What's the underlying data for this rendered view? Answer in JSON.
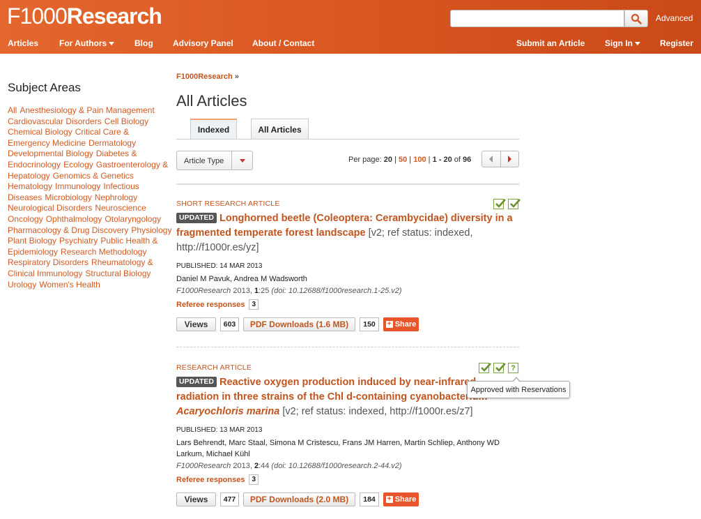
{
  "header": {
    "logo_light": "F1000",
    "logo_bold": "Research",
    "search": {
      "value": "",
      "placeholder": ""
    },
    "advanced": "Advanced",
    "nav_left": [
      "Articles",
      "For Authors",
      "Blog",
      "Advisory Panel",
      "About / Contact"
    ],
    "nav_right": [
      "Submit an Article",
      "Sign In",
      "Register"
    ]
  },
  "sidebar": {
    "title": "Subject Areas",
    "subjects": [
      "All",
      "Anesthesiology & Pain Management",
      "Cardiovascular Disorders",
      "Cell Biology",
      "Chemical Biology",
      "Critical Care &",
      "Emergency Medicine",
      "Dermatology",
      "Developmental Biology",
      "Diabetes &",
      "Endocrinology",
      "Ecology",
      "Gastroenterology &",
      "Hepatology",
      "Genomics & Genetics",
      "Hematology",
      "Immunology",
      "Infectious",
      "Diseases",
      "Microbiology",
      "Nephrology",
      "Neurological Disorders",
      "Neuroscience",
      "Oncology",
      "Ophthalmology",
      "Otolaryngology",
      "Pharmacology & Drug Discovery",
      "Physiology",
      "Plant Biology",
      "Psychiatry",
      "Public Health &",
      "Epidemiology",
      "Research Methodology",
      "Respiratory Disorders",
      "Rheumatology &",
      "Clinical Immunology",
      "Structural Biology",
      "Urology",
      "Women's Health"
    ]
  },
  "breadcrumb": {
    "home": "F1000Research",
    "sep": "»"
  },
  "page_title": "All Articles",
  "tabs": [
    "Indexed",
    "All Articles"
  ],
  "filter": {
    "article_type": "Article Type"
  },
  "pagination": {
    "per_page_label": "Per page:",
    "current": "20",
    "options": [
      "50",
      "100"
    ],
    "range": "1 - 20",
    "of": "of",
    "total": "96"
  },
  "articles": [
    {
      "type": "SHORT RESEARCH ARTICLE",
      "badge": "UPDATED",
      "title": "Longhorned beetle (Coleoptera: Cerambycidae) diversity in a fragmented temperate forest landscape",
      "meta": "[v2; ref status: indexed, http://f1000r.es/yz]",
      "published": "PUBLISHED: 14 MAR 2013",
      "authors": "Daniel M Pavuk, Andrea M Wadsworth",
      "journal": "F1000Research",
      "year_vol": "2013,",
      "volume": "1",
      "page": ":25",
      "doi": "(doi: 10.12688/f1000research.1-25.v2)",
      "referee_label": "Referee responses",
      "referee_count": "3",
      "views_label": "Views",
      "views": "603",
      "pdf_label": "PDF Downloads (1.6 MB)",
      "downloads": "150",
      "share_label": "Share",
      "statuses": [
        "approved",
        "approved"
      ]
    },
    {
      "type": "RESEARCH ARTICLE",
      "badge": "UPDATED",
      "title": "Reactive oxygen production induced by near-infrared radiation in three strains of the Chl d-containing cyanobacterium",
      "title_italic": "Acaryochloris marina",
      "meta": "[v2; ref status: indexed, http://f1000r.es/z7]",
      "published": "PUBLISHED: 13 MAR 2013",
      "authors": "Lars Behrendt, Marc Staal, Simona M Cristescu, Frans JM Harren, Martin Schliep, Anthony WD Larkum, Michael Kühl",
      "journal": "F1000Research",
      "year_vol": "2013,",
      "volume": "2",
      "page": ":44",
      "doi": "(doi: 10.12688/f1000research.2-44.v2)",
      "referee_label": "Referee responses",
      "referee_count": "3",
      "views_label": "Views",
      "views": "477",
      "pdf_label": "PDF Downloads (2.0 MB)",
      "downloads": "184",
      "share_label": "Share",
      "statuses": [
        "approved",
        "approved",
        "approved-with-reservations"
      ],
      "tooltip": "Approved with Reservations"
    }
  ],
  "colors": {
    "brand_orange": "#d8551f",
    "link": "#c0551f",
    "share": "#e8542c",
    "check_green": "#6c8f2e"
  }
}
